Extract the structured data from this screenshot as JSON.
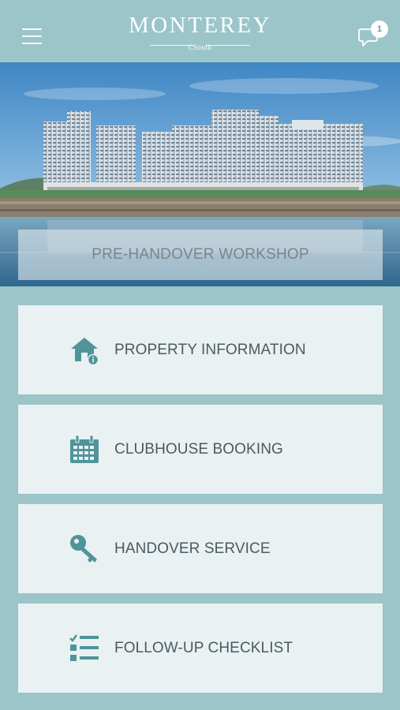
{
  "header": {
    "logo_text": "MONTEREY",
    "logo_sub": "CSouth",
    "notification_count": "1"
  },
  "hero": {
    "banner_label": "PRE-HANDOVER WORKSHOP"
  },
  "menu": {
    "items": [
      {
        "label": "PROPERTY INFORMATION",
        "icon": "house-info-icon"
      },
      {
        "label": "CLUBHOUSE BOOKING",
        "icon": "calendar-icon"
      },
      {
        "label": "HANDOVER SERVICE",
        "icon": "key-icon"
      },
      {
        "label": "FOLLOW-UP CHECKLIST",
        "icon": "checklist-icon"
      }
    ]
  },
  "colors": {
    "brand_teal": "#9bc5c8",
    "icon_teal": "#4f9499",
    "card_bg": "#e9f1f3",
    "text": "#4c5a60"
  }
}
